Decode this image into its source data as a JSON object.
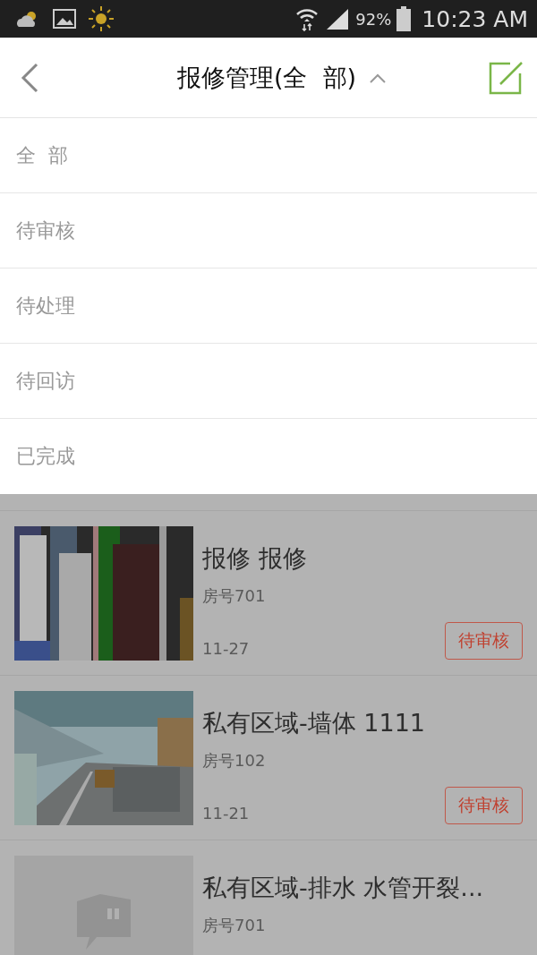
{
  "status_bar": {
    "battery": "92%",
    "time": "10:23 AM"
  },
  "header": {
    "title": "报修管理(全  部)",
    "expanded": true
  },
  "filter_menu": [
    {
      "label": "全  部"
    },
    {
      "label": "待审核"
    },
    {
      "label": "待处理"
    },
    {
      "label": "待回访"
    },
    {
      "label": "已完成"
    }
  ],
  "repairs": [
    {
      "kind": "picture",
      "title": "报修 报修",
      "room": "房号701",
      "date": "11-27",
      "status": "待审核"
    },
    {
      "kind": "picture",
      "title": "私有区域-墙体 1111",
      "room": "房号102",
      "date": "11-21",
      "status": "待审核"
    },
    {
      "kind": "placeholder",
      "title": "私有区域-排水 水管开裂...",
      "room": "房号701"
    }
  ]
}
